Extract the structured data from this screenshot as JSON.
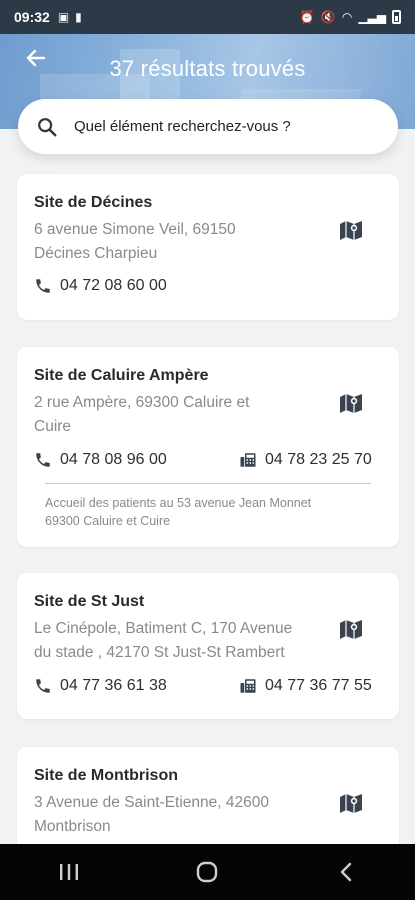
{
  "status_bar": {
    "time": "09:32"
  },
  "header": {
    "title": "37 résultats trouvés"
  },
  "search": {
    "placeholder": "Quel élément recherchez-vous ?"
  },
  "results": [
    {
      "title": "Site de Décines",
      "address_line1": "6 avenue Simone Veil, 69150",
      "address_line2": "Décines Charpieu",
      "phone": "04 72 08 60 00"
    },
    {
      "title": "Site de Caluire Ampère",
      "address_line1": "2 rue Ampère, 69300 Caluire et",
      "address_line2": "Cuire",
      "phone": "04 78 08 96 00",
      "fax": "04 78 23 25 70",
      "note_line1": "Accueil des patients au 53 avenue Jean Monnet",
      "note_line2": "69300 Caluire et Cuire"
    },
    {
      "title": "Site de St Just",
      "address_line1": "Le Cinépole, Batiment C, 170 Avenue",
      "address_line2": "du stade , 42170 St Just-St Rambert",
      "phone": "04 77 36 61 38",
      "fax": "04 77 36 77 55"
    },
    {
      "title": "Site de Montbrison",
      "address_line1": "3 Avenue de Saint-Etienne, 42600",
      "address_line2": "Montbrison"
    }
  ],
  "colors": {
    "header_gradient": "#8cb4dd",
    "text_dark": "#2a2a2a",
    "text_muted": "#8a8a8a",
    "icon": "#3a4450",
    "background": "#f1f2f4"
  },
  "icons": {
    "back": "arrow-left-icon",
    "search": "magnifier-icon",
    "map": "folded-map-pin-icon",
    "phone": "phone-handset-icon",
    "fax": "fax-machine-icon"
  }
}
